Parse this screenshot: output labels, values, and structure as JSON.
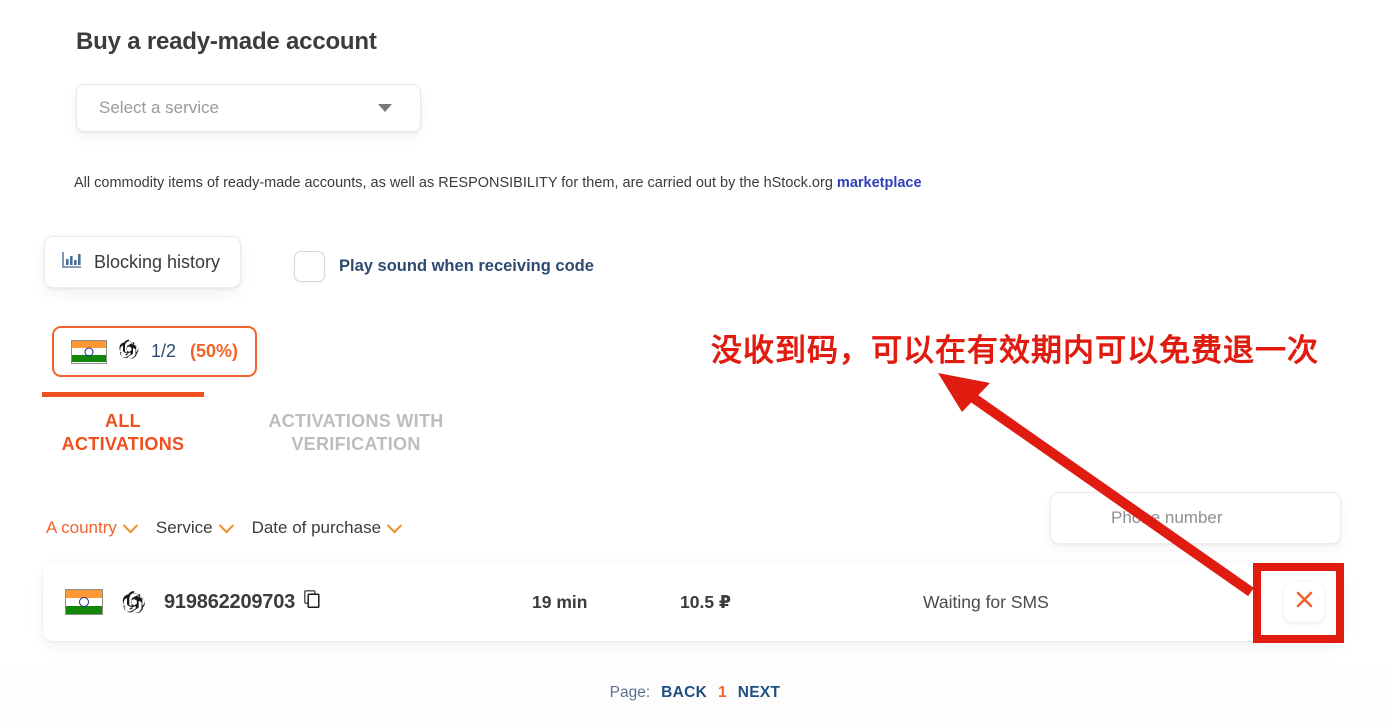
{
  "heading": "Buy a ready-made account",
  "service_select": {
    "placeholder": "Select a service",
    "value": "",
    "caret_icon": "chevron-down-icon"
  },
  "notice": {
    "text": "All commodity items of ready-made accounts, as well as RESPONSIBILITY for them, are carried out by the hStock.org ",
    "link_text": "marketplace",
    "link_color": "#2f3fb8"
  },
  "blocking_history": {
    "label": "Blocking history",
    "icon": "bar-chart-icon"
  },
  "sound_option": {
    "label": "Play sound when receiving code",
    "checked": false
  },
  "stats_badge": {
    "country_icon": "india-flag-icon",
    "service_icon": "openai-logo-icon",
    "fraction": "1/2",
    "percent": "(50%)",
    "border_color": "#f0632a"
  },
  "tabs": [
    {
      "label": "ALL ACTIVATIONS",
      "active": true
    },
    {
      "label": "ACTIVATIONS WITH VERIFICATION",
      "active": false
    }
  ],
  "filters": [
    {
      "label": "A country",
      "active": true,
      "icon": "chevron-down-icon"
    },
    {
      "label": "Service",
      "active": false,
      "icon": "chevron-down-icon"
    },
    {
      "label": "Date of purchase",
      "active": false,
      "icon": "chevron-down-icon"
    }
  ],
  "phone_search": {
    "placeholder": "Phone number",
    "value": ""
  },
  "activations": {
    "rows": [
      {
        "country_icon": "india-flag-icon",
        "service_icon": "openai-logo-icon",
        "phone": "919862209703",
        "copy_icon": "copy-icon",
        "time": "19 min",
        "price": "10.5 ₽",
        "status": "Waiting for SMS",
        "cancel_icon": "close-icon"
      }
    ]
  },
  "pagination": {
    "label": "Page:",
    "back": "BACK",
    "current": "1",
    "next": "NEXT"
  },
  "annotation": {
    "text": "没收到码，可以在有效期内可以免费退一次",
    "color": "#e01b10",
    "highlight_shape": "rectangle",
    "arrow": "arrow-pointing-up-left"
  },
  "theme": {
    "accent": "#f0632a",
    "tab_active": "#f0501e",
    "navy": "#2e4a70",
    "link": "#2f3fb8",
    "annotation_red": "#e01b10"
  }
}
